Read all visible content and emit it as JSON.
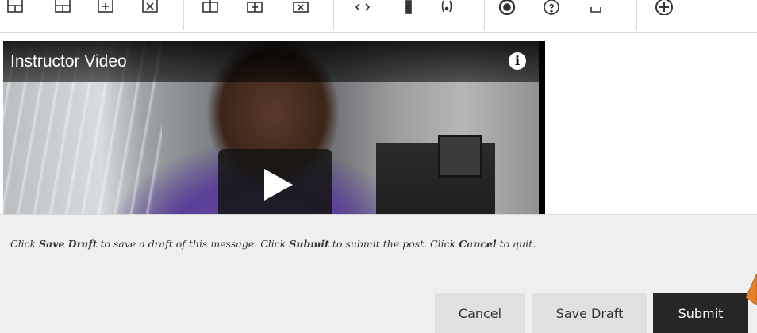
{
  "toolbar": {
    "icons": [
      "table-icon",
      "table-row-icon",
      "table-insert-icon",
      "table-delete-icon",
      "insert-row-above-icon",
      "insert-row-below-icon",
      "delete-row-icon",
      "code-view-icon",
      "accessibility-icon",
      "special-chars-icon",
      "preview-icon",
      "help-icon",
      "fullscreen-icon",
      "add-content-icon"
    ]
  },
  "video": {
    "title": "Instructor Video",
    "info_icon": "info-icon",
    "play_icon": "play-icon"
  },
  "instructions": {
    "part1": "Click ",
    "save_draft": "Save Draft",
    "part2": " to save a draft of this message. Click ",
    "submit": "Submit",
    "part3": " to submit the post. Click ",
    "cancel": "Cancel",
    "part4": " to quit."
  },
  "actions": {
    "cancel_label": "Cancel",
    "save_draft_label": "Save Draft",
    "submit_label": "Submit"
  },
  "colors": {
    "submit_bg": "#262626",
    "secondary_bg": "#e0e0e0",
    "panel_bg": "#efefef",
    "pointer": "#e8822a"
  }
}
